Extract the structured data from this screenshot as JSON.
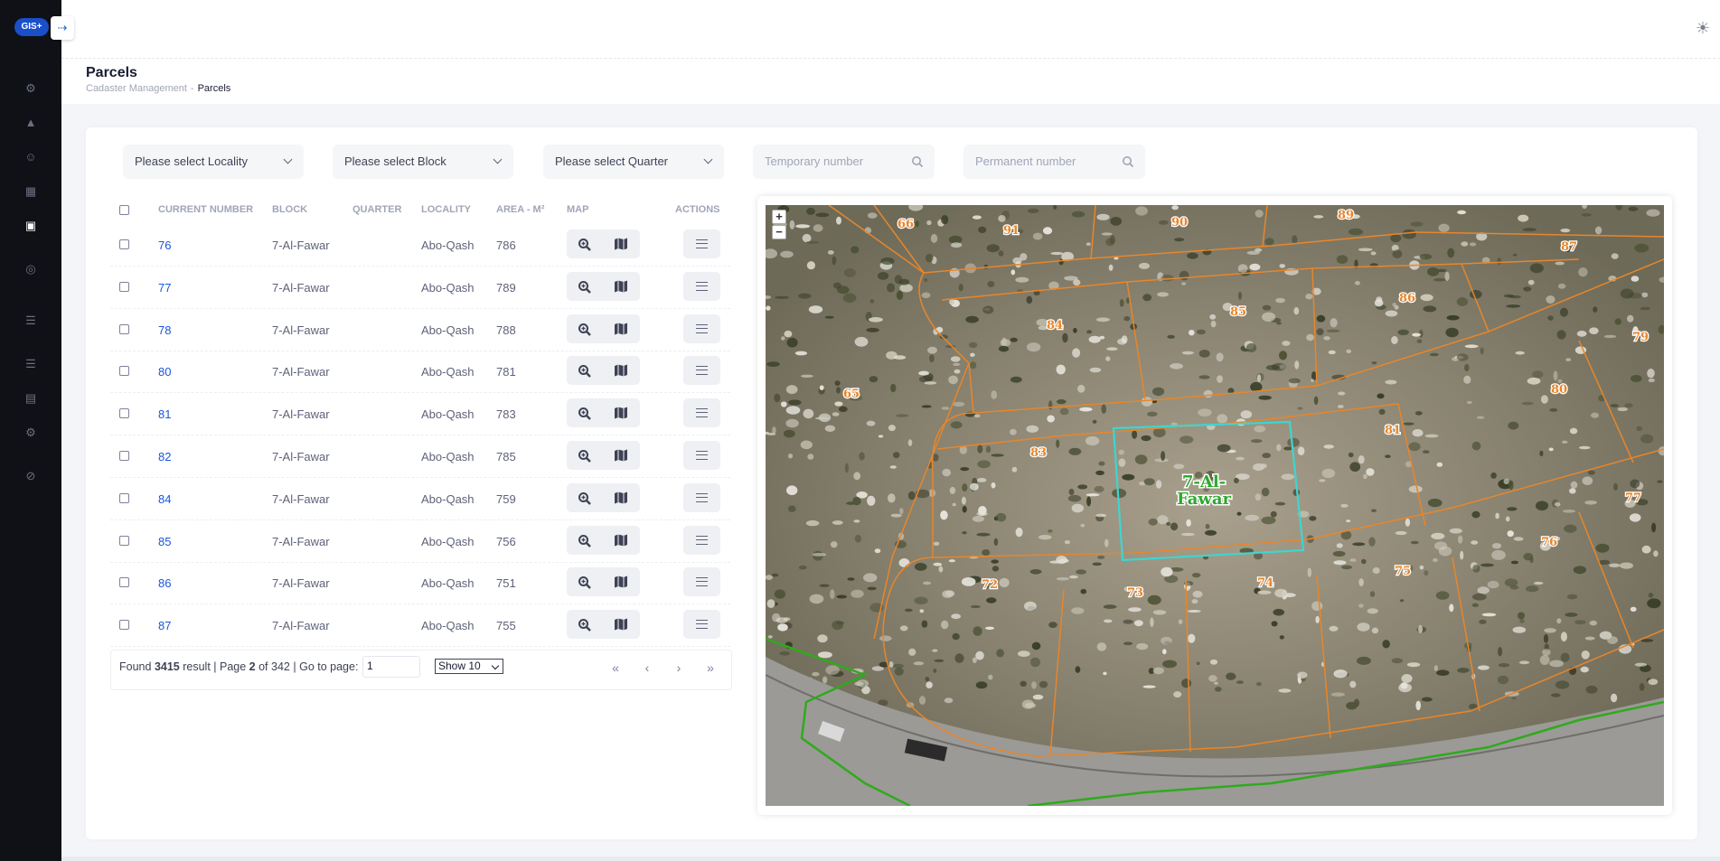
{
  "app": {
    "logo": "GIS+",
    "collapse_icon": "arrow-right-icon"
  },
  "sidebar": {
    "items": [
      {
        "icon": "settings-icon",
        "glyph": "⚙"
      },
      {
        "icon": "chart-icon",
        "glyph": "▲"
      },
      {
        "icon": "user-icon",
        "glyph": "☺"
      },
      {
        "icon": "map-icon",
        "glyph": "▦"
      },
      {
        "icon": "parcels-icon",
        "glyph": "▣"
      },
      {
        "icon": "target-icon",
        "glyph": "◎"
      },
      {
        "icon": "table-icon",
        "glyph": "☰"
      },
      {
        "icon": "list-icon",
        "glyph": "☰"
      },
      {
        "icon": "document-icon",
        "glyph": "▤"
      },
      {
        "icon": "gear-icon",
        "glyph": "⚙"
      },
      {
        "icon": "attachment-icon",
        "glyph": "⊘"
      }
    ]
  },
  "header": {
    "title": "Parcels",
    "breadcrumb": [
      "Cadaster Management",
      "Parcels"
    ],
    "breadcrumb_sep": "-"
  },
  "filters": {
    "locality": "Please select Locality",
    "block": "Please select Block",
    "quarter": "Please select Quarter",
    "temporary_placeholder": "Temporary number",
    "permanent_placeholder": "Permanent number"
  },
  "table": {
    "columns": [
      "CURRENT NUMBER",
      "BLOCK",
      "QUARTER",
      "LOCALITY",
      "AREA - M²",
      "MAP",
      "ACTIONS"
    ],
    "rows": [
      {
        "number": "76",
        "block": "7-Al-Fawar",
        "quarter": "",
        "locality": "Abo-Qash",
        "area": "786"
      },
      {
        "number": "77",
        "block": "7-Al-Fawar",
        "quarter": "",
        "locality": "Abo-Qash",
        "area": "789"
      },
      {
        "number": "78",
        "block": "7-Al-Fawar",
        "quarter": "",
        "locality": "Abo-Qash",
        "area": "788"
      },
      {
        "number": "80",
        "block": "7-Al-Fawar",
        "quarter": "",
        "locality": "Abo-Qash",
        "area": "781"
      },
      {
        "number": "81",
        "block": "7-Al-Fawar",
        "quarter": "",
        "locality": "Abo-Qash",
        "area": "783"
      },
      {
        "number": "82",
        "block": "7-Al-Fawar",
        "quarter": "",
        "locality": "Abo-Qash",
        "area": "785"
      },
      {
        "number": "84",
        "block": "7-Al-Fawar",
        "quarter": "",
        "locality": "Abo-Qash",
        "area": "759"
      },
      {
        "number": "85",
        "block": "7-Al-Fawar",
        "quarter": "",
        "locality": "Abo-Qash",
        "area": "756"
      },
      {
        "number": "86",
        "block": "7-Al-Fawar",
        "quarter": "",
        "locality": "Abo-Qash",
        "area": "751"
      },
      {
        "number": "87",
        "block": "7-Al-Fawar",
        "quarter": "",
        "locality": "Abo-Qash",
        "area": "755"
      }
    ]
  },
  "pagination": {
    "found_label": "Found",
    "total": "3415",
    "result_label": "result | Page",
    "page": "2",
    "of_label": "of",
    "pages": "342",
    "goto_label": "| Go to page:",
    "goto_value": "1",
    "show": "Show 10",
    "first": "«",
    "prev": "‹",
    "next": "›",
    "last": "»"
  },
  "map": {
    "zoom_in": "+",
    "zoom_out": "−",
    "selected_block_label": [
      "7-Al-",
      "Fawar"
    ],
    "parcel_labels": [
      "66",
      "91",
      "90",
      "89",
      "87",
      "84",
      "85",
      "86",
      "79",
      "65",
      "80",
      "83",
      "81",
      "77",
      "76",
      "72",
      "73",
      "74",
      "75"
    ],
    "colors": {
      "parcel": "#e8862a",
      "selected": "#3dd6d0",
      "block_label": "#2fa82f",
      "road": "#2faa1d"
    }
  },
  "topbar": {
    "theme_icon": "sun-icon",
    "avatar": "avatar"
  }
}
